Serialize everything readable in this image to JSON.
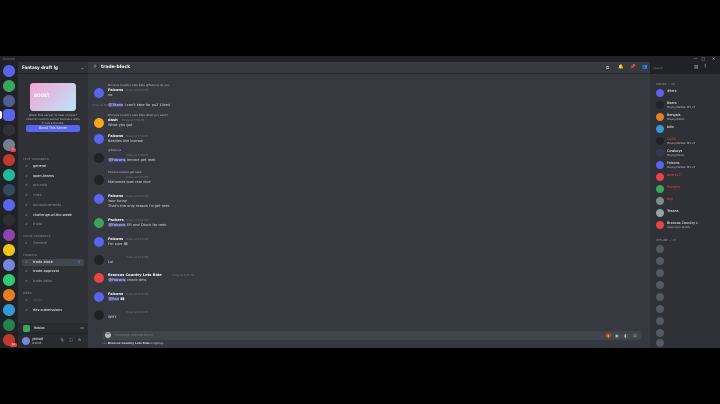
{
  "titlebar": {
    "app_name": "Discord",
    "minimize": "—",
    "maximize": "□",
    "close": "✕"
  },
  "server": {
    "name": "Fantasy draft lg"
  },
  "boost": {
    "art_label": "BOOST",
    "text_line1": "Want this server to feel unique?",
    "text_line2": "Unlock custom server banners with",
    "text_line3": "7 more boosts.",
    "button": "Boost This Server"
  },
  "sidebar": {
    "categories": [
      "TEXT CHANNELS",
      "VOICE CHANNELS",
      "TRADING",
      "WEEK"
    ],
    "channels": [
      {
        "name": "general",
        "state": "unread"
      },
      {
        "name": "open-teams",
        "state": "unread"
      },
      {
        "name": "pre-rolls",
        "state": "normal"
      },
      {
        "name": "rules",
        "state": "normal"
      },
      {
        "name": "announcements",
        "state": "normal"
      },
      {
        "name": "challenge-of-the-week",
        "state": "unread"
      },
      {
        "name": "trivia",
        "state": "normal"
      },
      {
        "name": "General",
        "state": "normal"
      },
      {
        "name": "trade-block",
        "state": "selected"
      },
      {
        "name": "trade-approval",
        "state": "unread"
      },
      {
        "name": "trade-talks",
        "state": "normal"
      },
      {
        "name": "plays",
        "state": "muted"
      },
      {
        "name": "dev-submissions",
        "state": "unread"
      }
    ]
  },
  "voice": {
    "label": "Roblox"
  },
  "user": {
    "name": "ykklo6",
    "tag": "#4038"
  },
  "rail": {
    "mention_badge": "1",
    "bottom_badge": "10"
  },
  "chat": {
    "channel": "trade-block",
    "search_placeholder": "Search",
    "composer_placeholder": "Message #trade-block",
    "typing_user": "Broncos Country Lets Ride",
    "typing_suffix": "is typing...",
    "messages": [
      {
        "reply": "Broncos Country Lets Ride @Falcons do you",
        "author": "Falcons",
        "time": "Today at 5:49 PM",
        "text": "no"
      },
      {
        "author": "",
        "time": "Today at 5:50 PM",
        "text_mention": "@Titans",
        "text": " I can't take for ps2 10red"
      },
      {
        "reply": "Broncos Country Lets Ride what you want?",
        "author": "dash",
        "time": "Today at 5:54 PM",
        "text": "What you got"
      },
      {
        "author": "Falcons",
        "time": "Today at 5:58 PM",
        "text": "Besides like burrow"
      },
      {
        "reply": "@Falcons",
        "author": "",
        "time": "Today at 5:58 PM",
        "text_mention": "@Falcons",
        "text": " lemme get reek"
      },
      {
        "reply": "Falcons lemme get reek",
        "author": "",
        "time": "Today at 5:59 PM",
        "text": "Mahomes look real nice"
      },
      {
        "author": "Falcons",
        "time": "Today at 6:00 PM",
        "text": "Your funny",
        "text2": "That's the only reason I'd get reek"
      },
      {
        "author": "Packers",
        "time": "Today at 6:02 PM",
        "text_mention": "@Falcons",
        "text": " ER and Dtuck for reek"
      },
      {
        "author": "Falcons",
        "time": "Today at 6:04 PM",
        "text": "I'm sure 😂"
      },
      {
        "author": "",
        "time": "Today at 6:05 PM",
        "text": "Lol"
      },
      {
        "author": "Broncos Country Lets Ride",
        "time": "Today at 6:06 PM",
        "text_mention": "@Falcons",
        "text": " check dms"
      },
      {
        "author": "Falcons",
        "time": "Today at 6:06 PM",
        "text_mention": "@Raji",
        "text": " 👀"
      },
      {
        "author": "",
        "time": "Today at 6:10 PM",
        "text": "WHY"
      }
    ]
  },
  "members": {
    "online_header": "ONLINE — 16",
    "offline_header": "OFFLINE — 13",
    "online": [
      {
        "name": "49ers",
        "status": "",
        "color": "#ffffff"
      },
      {
        "name": "Bears",
        "status": "Playing Madden NFL 23",
        "color": "#ffffff"
      },
      {
        "name": "Bengals",
        "status": "Playing Roblox",
        "color": "#ffffff"
      },
      {
        "name": "bills",
        "status": "",
        "color": "#ffffff"
      },
      {
        "name": "Colts",
        "status": "Playing Madden NFL 23",
        "color": "#ed4245"
      },
      {
        "name": "Cowboys",
        "status": "Playing Roblox",
        "color": "#ffffff"
      },
      {
        "name": "Falcons",
        "status": "Playing Madden NFL 23",
        "color": "#ffffff"
      },
      {
        "name": "bears17",
        "status": "",
        "color": "#ed4245"
      },
      {
        "name": "Packers",
        "status": "",
        "color": "#ed4245"
      },
      {
        "name": "Raji",
        "status": "",
        "color": "#ed4245"
      },
      {
        "name": "Texans",
        "status": "",
        "color": "#ffffff"
      },
      {
        "name": "Broncos Country L",
        "status": "Listening to Spotify",
        "color": "#ffffff"
      }
    ],
    "offline": [
      {
        "name": "",
        "status": ""
      },
      {
        "name": "",
        "status": ""
      },
      {
        "name": "",
        "status": ""
      },
      {
        "name": "",
        "status": ""
      },
      {
        "name": "",
        "status": ""
      },
      {
        "name": "",
        "status": ""
      },
      {
        "name": "",
        "status": ""
      },
      {
        "name": "",
        "status": ""
      },
      {
        "name": "",
        "status": ""
      }
    ]
  }
}
